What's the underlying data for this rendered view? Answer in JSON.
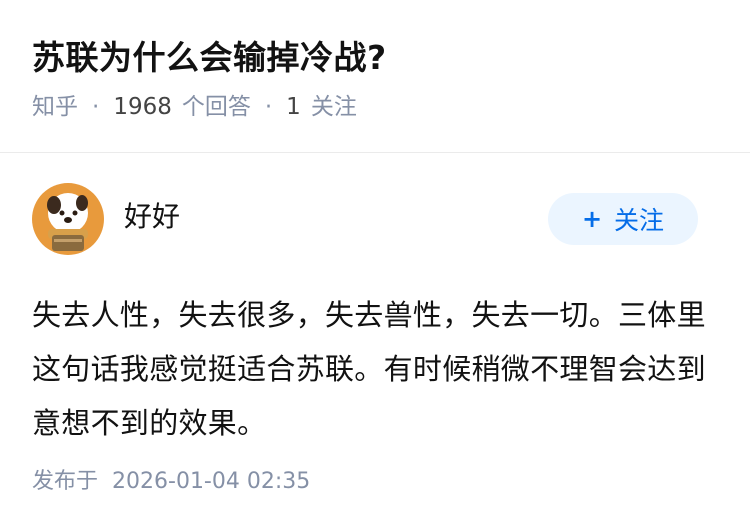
{
  "question": {
    "title": "苏联为什么会输掉冷战?",
    "source": "知乎",
    "answer_count": "1968",
    "answer_label": "个回答",
    "follow_count": "1",
    "follow_label": "关注"
  },
  "answer": {
    "author_name": "好好",
    "follow_button_label": "关注",
    "content": "失去人性，失去很多，失去兽性，失去一切。三体里这句话我感觉挺适合苏联。有时候稍微不理智会达到意想不到的效果。",
    "published_label": "发布于",
    "published_time": "2026-01-04 02:35"
  },
  "colors": {
    "accent": "#056de8",
    "button_bg": "#ebf5ff",
    "meta_gray": "#8590a6"
  }
}
